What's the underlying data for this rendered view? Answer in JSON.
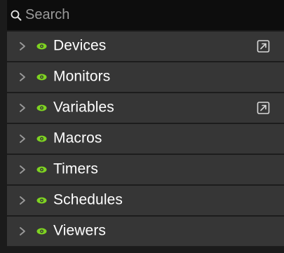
{
  "search": {
    "placeholder": "Search",
    "value": ""
  },
  "tree": {
    "items": [
      {
        "label": "Devices",
        "visible": true,
        "has_popout": true
      },
      {
        "label": "Monitors",
        "visible": true,
        "has_popout": false
      },
      {
        "label": "Variables",
        "visible": true,
        "has_popout": true
      },
      {
        "label": "Macros",
        "visible": true,
        "has_popout": false
      },
      {
        "label": "Timers",
        "visible": true,
        "has_popout": false
      },
      {
        "label": "Schedules",
        "visible": true,
        "has_popout": false
      },
      {
        "label": "Viewers",
        "visible": true,
        "has_popout": false
      }
    ]
  },
  "colors": {
    "background": "#1b1b1b",
    "search_background": "#0d0d0d",
    "row_background": "#363636",
    "eye_icon": "#7ed321",
    "chevron": "#9b9b9b",
    "text": "#ffffff"
  },
  "icons": {
    "search": "search-icon",
    "expand": "chevron-right-icon",
    "visibility": "eye-icon",
    "popout": "open-external-icon"
  }
}
